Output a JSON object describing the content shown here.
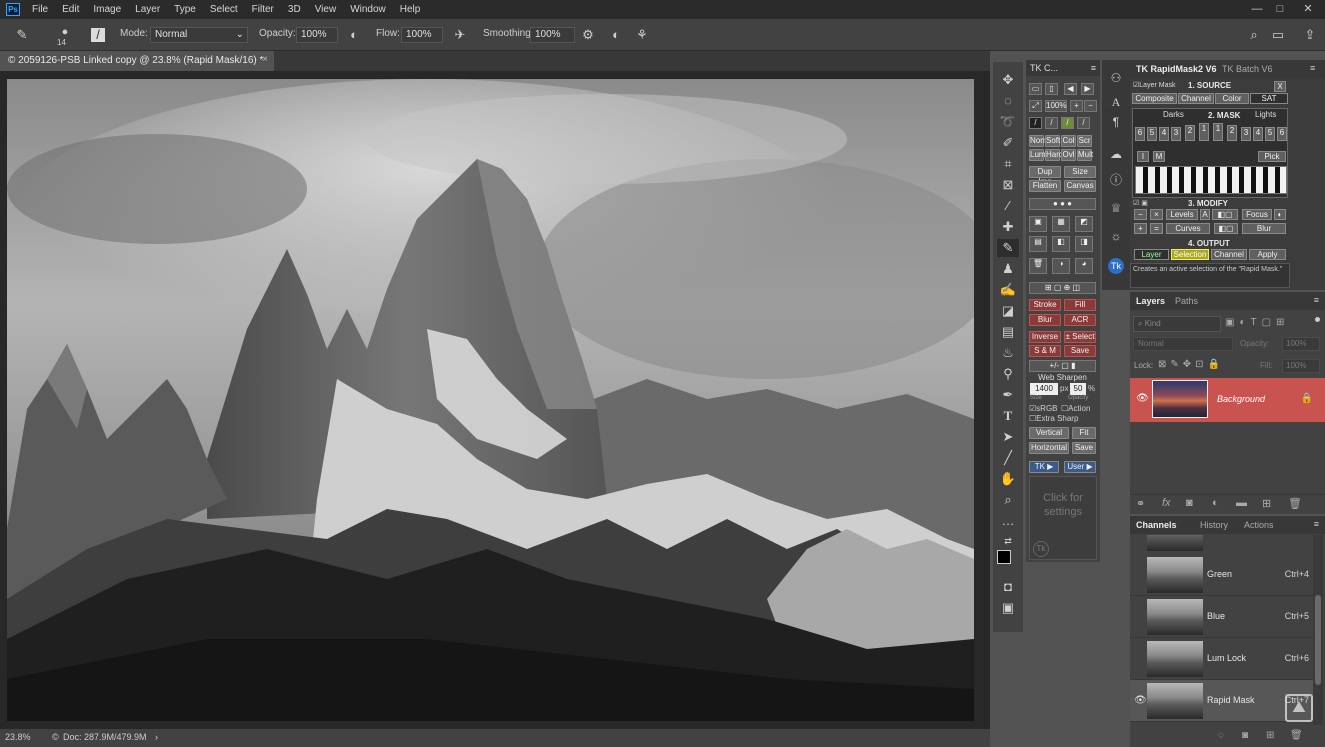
{
  "menubar": {
    "items": [
      "File",
      "Edit",
      "Image",
      "Layer",
      "Type",
      "Select",
      "Filter",
      "3D",
      "View",
      "Window",
      "Help"
    ],
    "app_badge": "Ps"
  },
  "options": {
    "brush_size": "14",
    "mode_label": "Mode:",
    "mode_value": "Normal",
    "opacity_label": "Opacity:",
    "opacity_value": "100%",
    "flow_label": "Flow:",
    "flow_value": "100%",
    "smoothing_label": "Smoothing:",
    "smoothing_value": "100%"
  },
  "document": {
    "tab_title": "© 2059126-PSB Linked copy @ 23.8% (Rapid Mask/16) *"
  },
  "status": {
    "zoom": "23.8%",
    "doc": "Doc: 287.9M/479.9M"
  },
  "tkc": {
    "title": "TK C...",
    "zoom": "100%",
    "row_norm": [
      "Norm",
      "Soft",
      "Col",
      "Scr"
    ],
    "row_lum": [
      "Lum",
      "Hard",
      "Ovl",
      "Mult"
    ],
    "dup": "Dup Img",
    "size": "Size",
    "flatten": "Flatten",
    "canvas": "Canvas",
    "stroke": "Stroke",
    "fill": "Fill",
    "blur": "Blur",
    "acr": "ACR",
    "inverse": "Inverse",
    "select": "± Select",
    "sm": "S & M",
    "save": "Save",
    "web_sharpen": "Web Sharpen",
    "web_size": "1400",
    "web_px": "px",
    "web_opacity": "50",
    "web_pct": "%",
    "size_lbl": "Size",
    "opacity_lbl": "Opacity",
    "srgb": "sRGB",
    "action": "Action",
    "extra": "Extra Sharp",
    "vertical": "Vertical",
    "fit": "Fit",
    "horizontal": "Horizontal",
    "save2": "Save",
    "tk": "TK ▶",
    "user": "User ▶",
    "click_settings": "Click for settings",
    "tk_logo": "Tk"
  },
  "rm": {
    "tab1": "TK RapidMask2 V6",
    "tab2": "TK Batch V6",
    "layer_mask": "Layer Mask",
    "source_hdr": "1. SOURCE",
    "x": "X",
    "source_btns": [
      "Composite",
      "Channel",
      "Color",
      "SAT"
    ],
    "mask_hdr": "2. MASK",
    "darks": "Darks",
    "lights": "Lights",
    "nums": [
      "6",
      "5",
      "4",
      "3",
      "2",
      "1",
      "1",
      "2",
      "3",
      "4",
      "5",
      "6"
    ],
    "i": "I",
    "m": "M",
    "pick": "Pick",
    "modify_hdr": "3. MODIFY",
    "levels": "Levels",
    "a": "A",
    "focus": "Focus",
    "curves": "Curves",
    "blur": "Blur",
    "output_hdr": "4. OUTPUT",
    "out_btns": [
      "Layer",
      "Selection",
      "Channel",
      "Apply"
    ],
    "tooltip": "Creates an active selection of the \"Rapid Mask.\""
  },
  "layers": {
    "tab1": "Layers",
    "tab2": "Paths",
    "kind": "Kind",
    "blend": "Normal",
    "opacity_label": "Opacity:",
    "opacity_value": "100%",
    "lock_label": "Lock:",
    "fill_label": "Fill:",
    "fill_value": "100%",
    "layer_name": "Background",
    "footer_icons": [
      "link-icon",
      "fx-icon",
      "mask-icon",
      "adjustment-icon",
      "folder-icon",
      "new-layer-icon",
      "trash-icon"
    ]
  },
  "channels": {
    "tab1": "Channels",
    "tab2": "History",
    "tab3": "Actions",
    "rows": [
      {
        "name": "Green",
        "key": "Ctrl+4"
      },
      {
        "name": "Blue",
        "key": "Ctrl+5"
      },
      {
        "name": "Lum Lock",
        "key": "Ctrl+6"
      },
      {
        "name": "Rapid Mask",
        "key": "Ctrl+7"
      }
    ]
  },
  "colors": {
    "accent_blue": "#31a8ff",
    "layer_selected": "#c9544f",
    "menubar": "#2b2b2b",
    "panel": "#424242"
  }
}
